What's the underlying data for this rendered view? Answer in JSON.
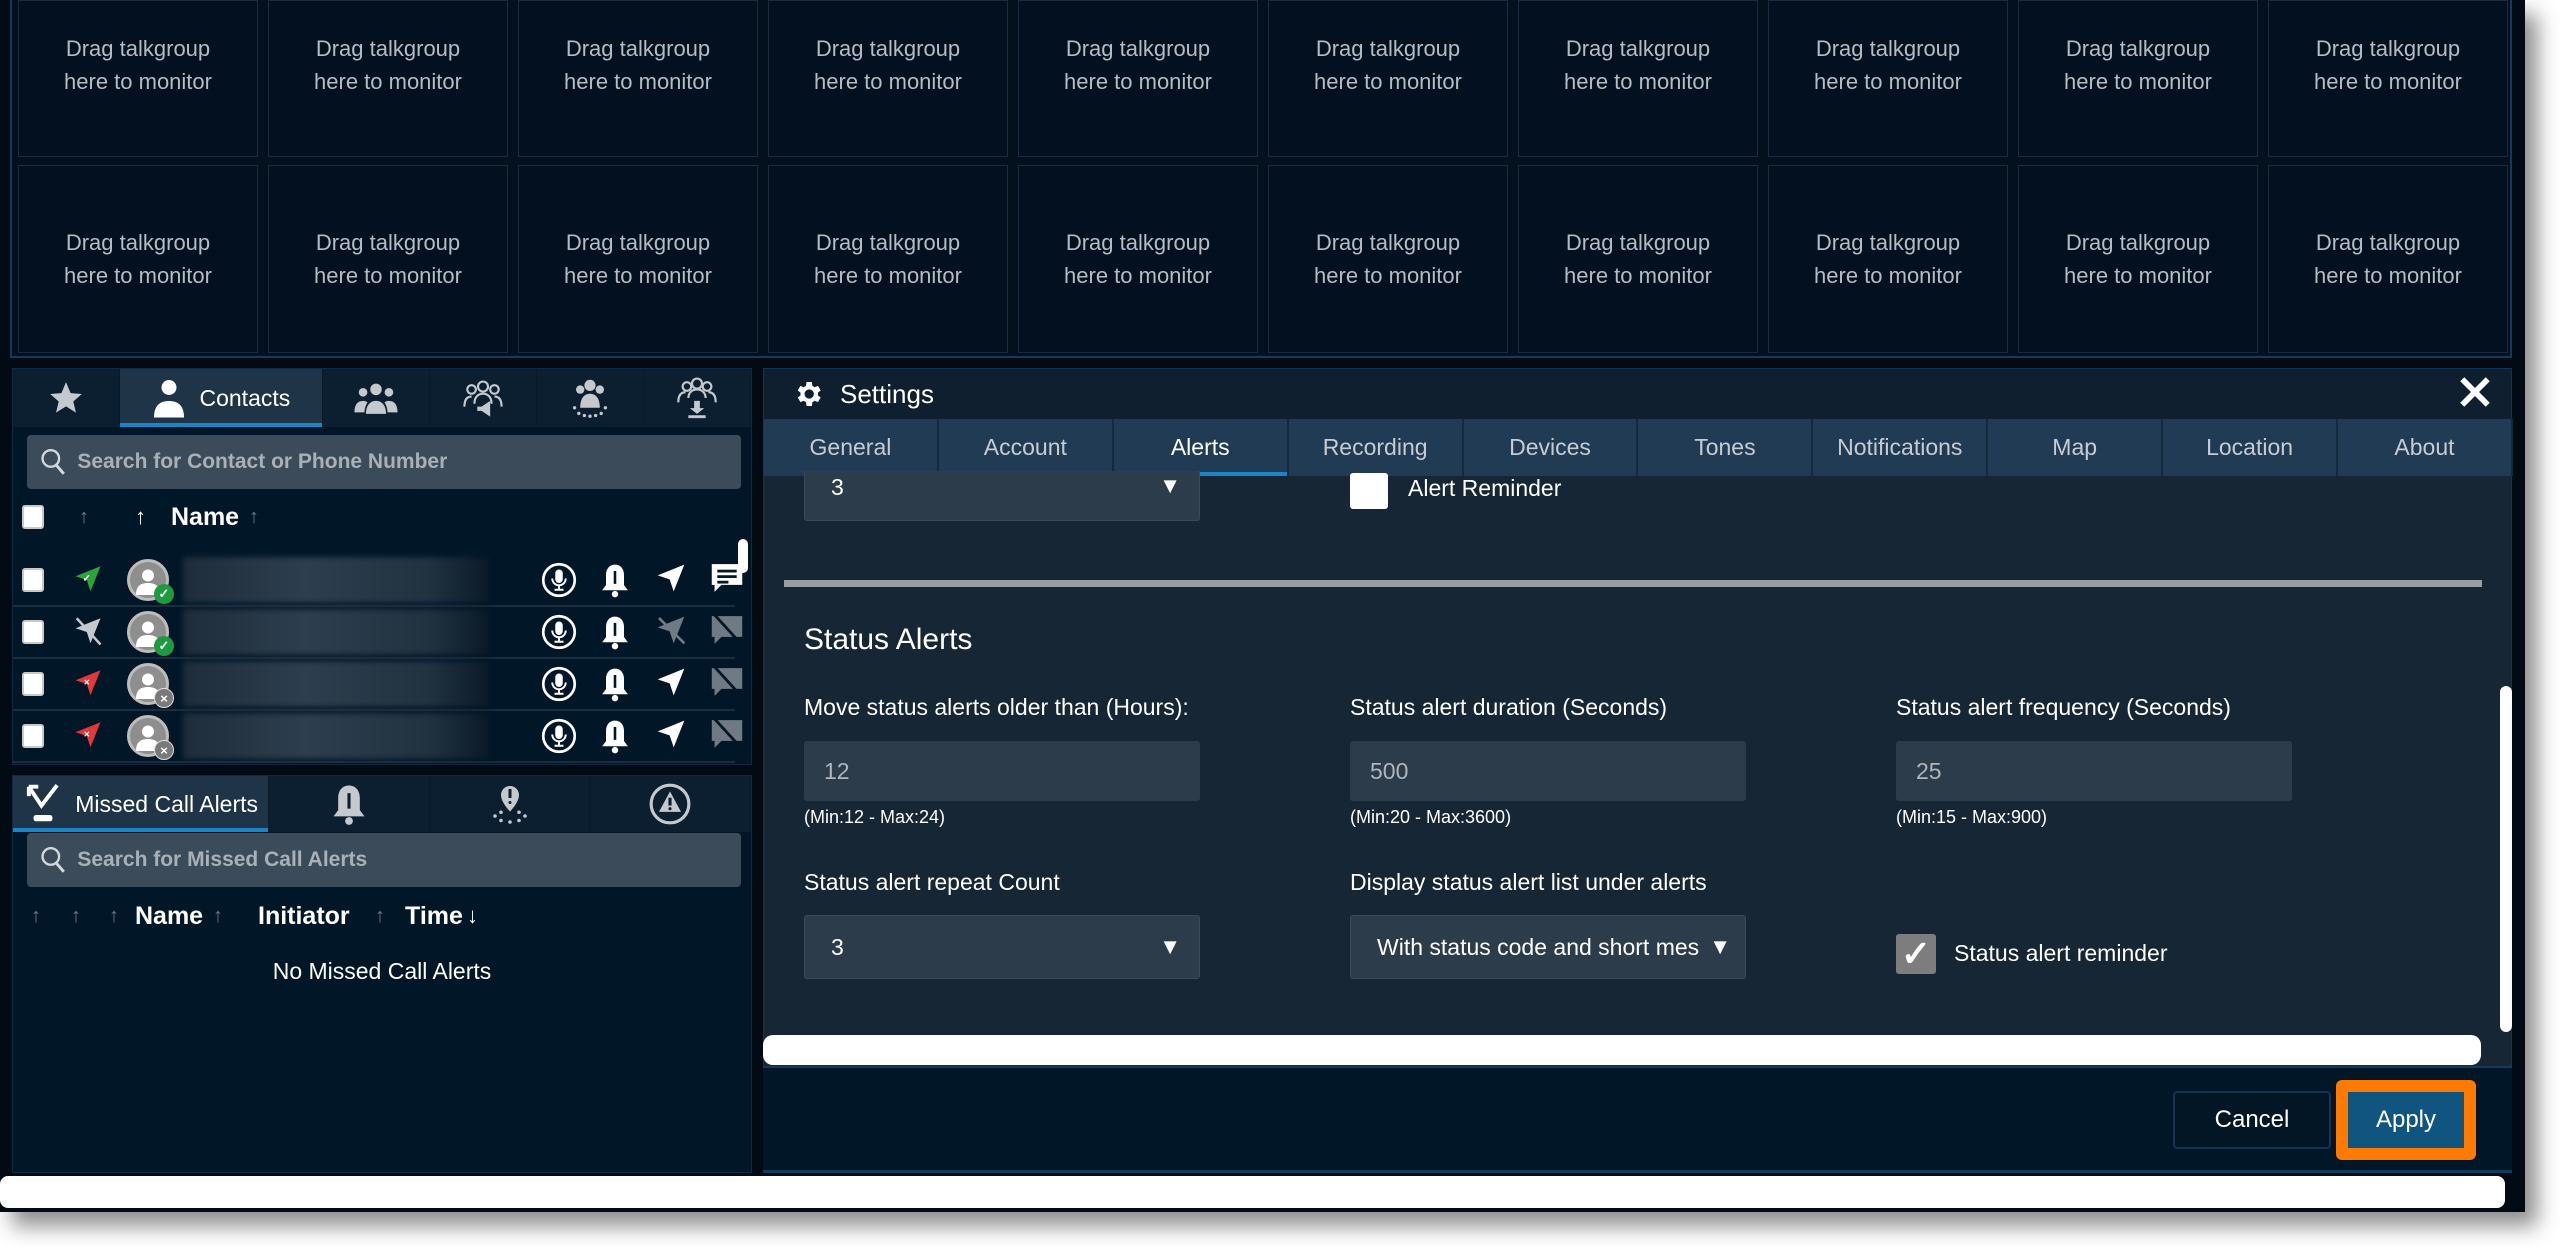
{
  "talkgroup_grid": {
    "tile_text_line1": "Drag talkgroup",
    "tile_text_line2": "here to monitor",
    "rows": 2,
    "columns": 10
  },
  "contacts_panel": {
    "tabs": [
      {
        "icon": "star-icon",
        "label": ""
      },
      {
        "icon": "person-icon",
        "label": "Contacts",
        "active": true
      },
      {
        "icon": "group-icon",
        "label": ""
      },
      {
        "icon": "group-broadcast-icon",
        "label": ""
      },
      {
        "icon": "dynamic-group-icon",
        "label": ""
      },
      {
        "icon": "group-download-icon",
        "label": ""
      }
    ],
    "search_placeholder": "Search for Contact or Phone Number",
    "header": {
      "name_label": "Name"
    },
    "rows": [
      {
        "location": "location-available",
        "presence": "online",
        "message": "enabled",
        "location_action": "enabled"
      },
      {
        "location": "location-disabled",
        "presence": "online",
        "message": "disabled",
        "location_action": "disabled"
      },
      {
        "location": "location-unavailable",
        "presence": "offline",
        "message": "disabled",
        "location_action": "enabled"
      },
      {
        "location": "location-unavailable",
        "presence": "offline",
        "message": "disabled",
        "location_action": "enabled"
      }
    ]
  },
  "missed_panel": {
    "tabs": [
      {
        "icon": "missed-call-icon",
        "label": "Missed Call Alerts",
        "active": true
      },
      {
        "icon": "bell-alert-icon",
        "label": ""
      },
      {
        "icon": "geofence-icon",
        "label": ""
      },
      {
        "icon": "warning-icon",
        "label": ""
      }
    ],
    "search_placeholder": "Search for Missed Call Alerts",
    "headers": {
      "name": "Name",
      "initiator": "Initiator",
      "time": "Time"
    },
    "empty_text": "No Missed Call Alerts"
  },
  "settings": {
    "title": "Settings",
    "close_label": "X",
    "tabs": [
      "General",
      "Account",
      "Alerts",
      "Recording",
      "Devices",
      "Tones",
      "Notifications",
      "Map",
      "Location",
      "About"
    ],
    "active_tab": "Alerts",
    "top_select_value": "3",
    "alert_reminder_label": "Alert Reminder",
    "alert_reminder_checked": false,
    "section_title": "Status Alerts",
    "fields": {
      "move_older": {
        "label": "Move status alerts older than (Hours):",
        "value": "12",
        "hint": "(Min:12 - Max:24)"
      },
      "duration": {
        "label": "Status alert duration (Seconds)",
        "value": "500",
        "hint": "(Min:20 - Max:3600)"
      },
      "frequency": {
        "label": "Status alert frequency (Seconds)",
        "value": "25",
        "hint": "(Min:15 - Max:900)"
      },
      "repeat_count": {
        "label": "Status alert repeat Count",
        "value": "3"
      },
      "display_list": {
        "label": "Display status alert list under alerts",
        "value": "With status code and short mes"
      },
      "status_reminder": {
        "label": "Status alert reminder",
        "checked": true
      }
    },
    "cancel_label": "Cancel",
    "apply_label": "Apply",
    "highlight_color": "#ff7a00",
    "accent_color": "#1a86c8"
  }
}
